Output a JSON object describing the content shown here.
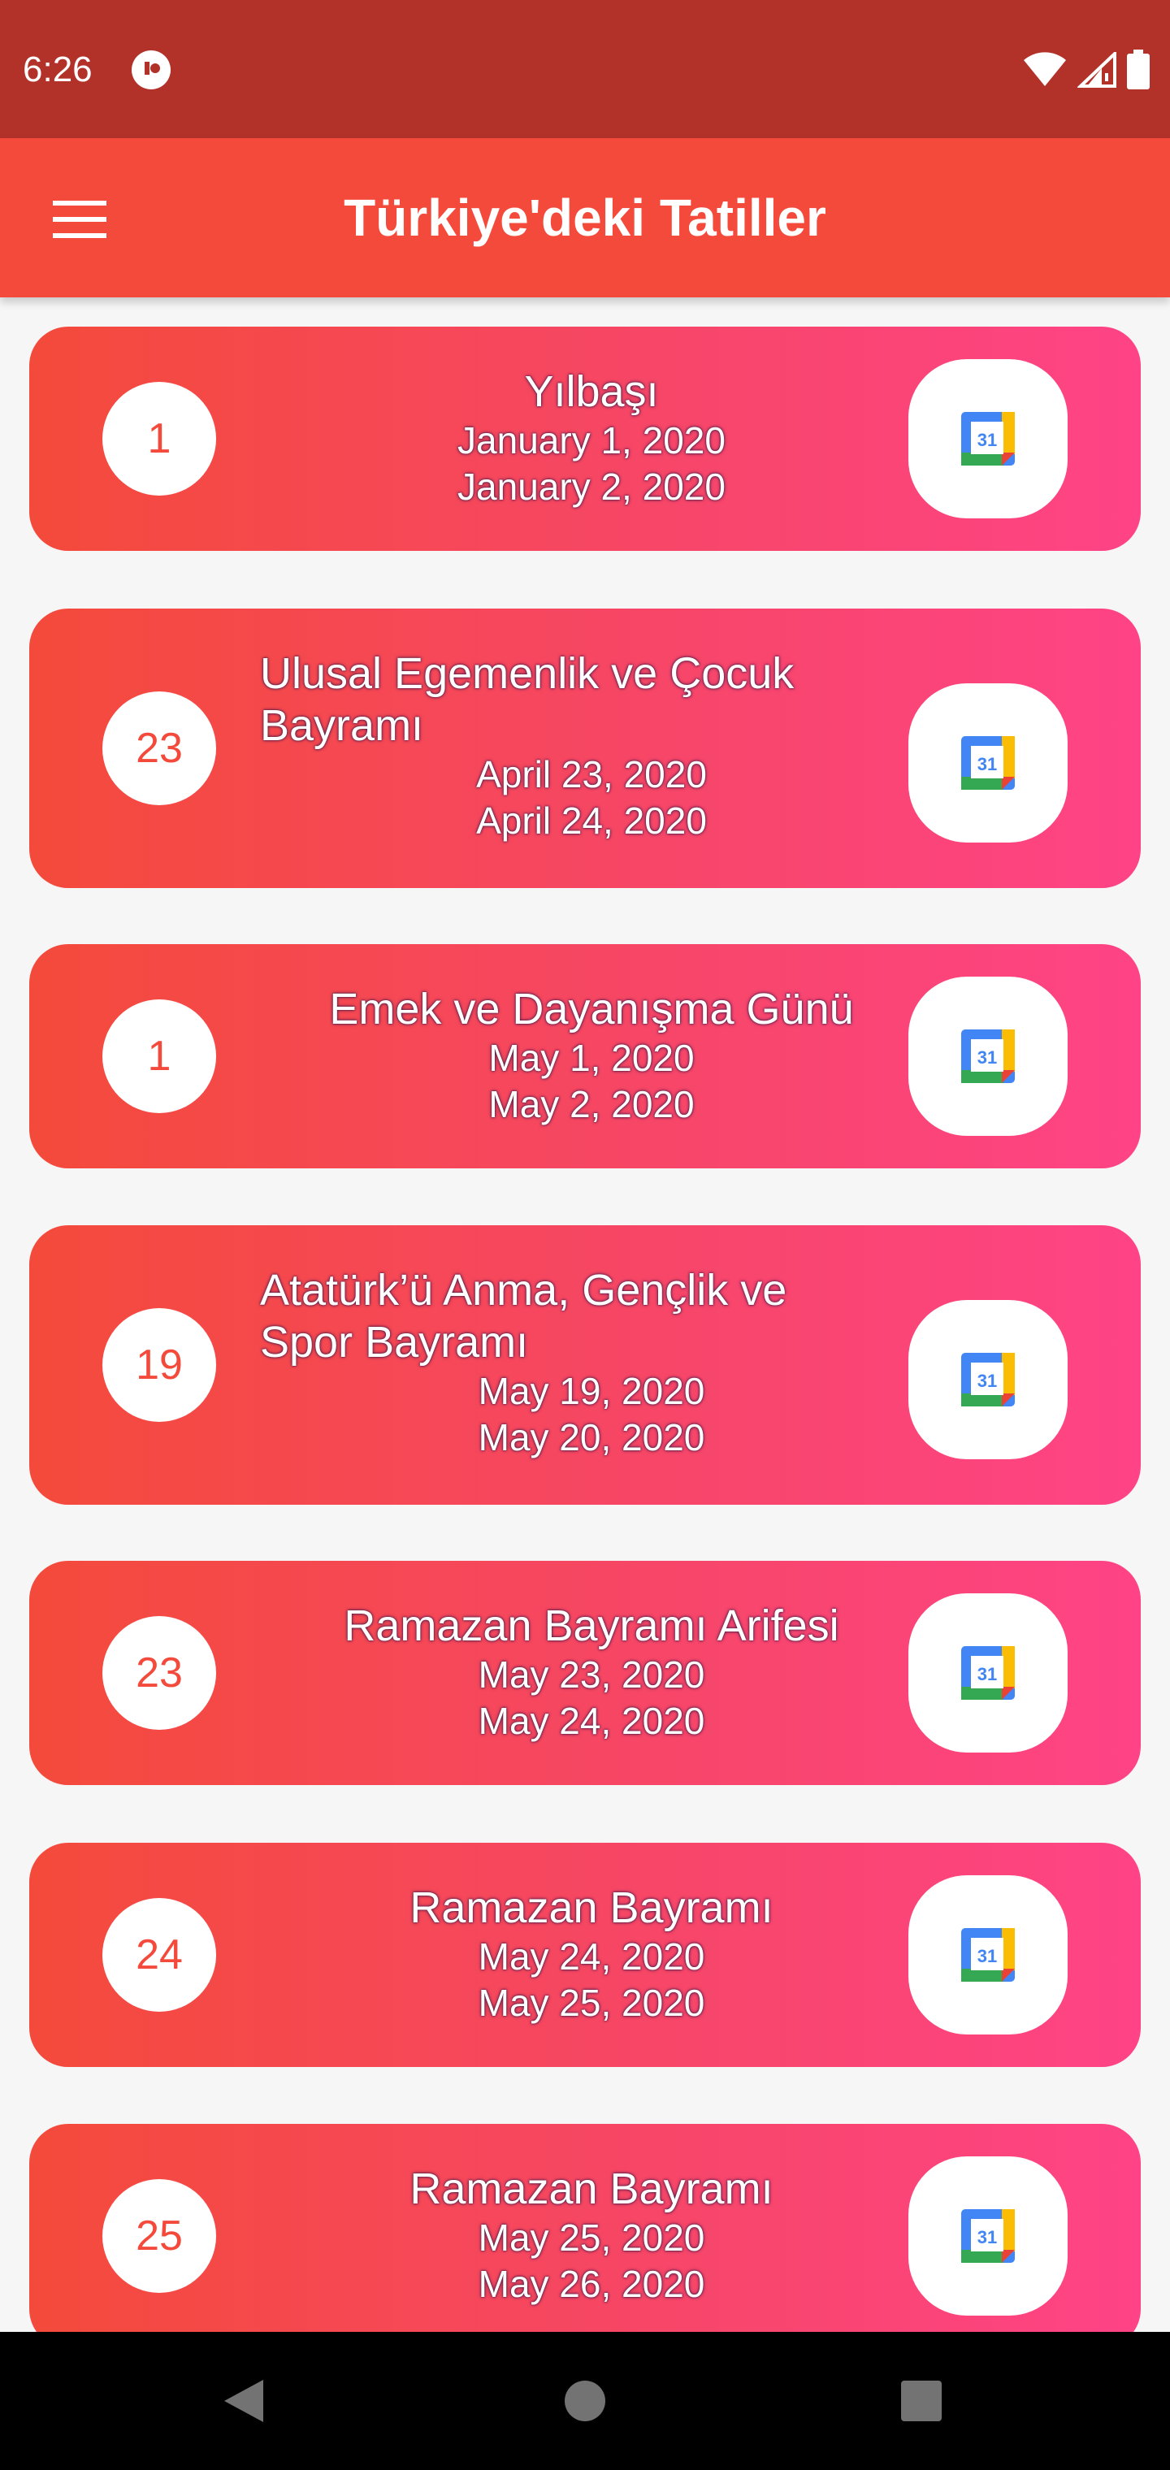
{
  "status_bar": {
    "time": "6:26"
  },
  "app_bar": {
    "title": "Türkiye'deki Tatiller"
  },
  "holidays": [
    {
      "day": "1",
      "name": "Yılbaşı",
      "start": "January 1, 2020",
      "end": "January 2, 2020"
    },
    {
      "day": "23",
      "name": "Ulusal Egemenlik ve Çocuk Bayramı",
      "start": "April 23, 2020",
      "end": "April 24, 2020"
    },
    {
      "day": "1",
      "name": "Emek ve Dayanışma Günü",
      "start": "May 1, 2020",
      "end": "May 2, 2020"
    },
    {
      "day": "19",
      "name": "Atatürk’ü Anma, Gençlik ve Spor Bayramı",
      "start": "May 19, 2020",
      "end": "May 20, 2020"
    },
    {
      "day": "23",
      "name": "Ramazan Bayramı Arifesi",
      "start": "May 23, 2020",
      "end": "May 24, 2020"
    },
    {
      "day": "24",
      "name": "Ramazan Bayramı",
      "start": "May 24, 2020",
      "end": "May 25, 2020"
    },
    {
      "day": "25",
      "name": "Ramazan Bayramı",
      "start": "May 25, 2020",
      "end": "May 26, 2020"
    }
  ],
  "calendar_icon_text": "31",
  "colors": {
    "status_bar": "#b2322a",
    "app_bar": "#f44a3b",
    "card_gradient_start": "#f44a3b",
    "card_gradient_end": "#ff4386",
    "background": "#f6f6f6"
  },
  "icons": {
    "menu": "hamburger-menu-icon",
    "calendar": "google-calendar-icon",
    "wifi": "wifi-icon",
    "signal": "signal-icon",
    "battery": "battery-icon",
    "back": "back-triangle-icon",
    "home": "home-circle-icon",
    "recents": "recents-square-icon"
  }
}
